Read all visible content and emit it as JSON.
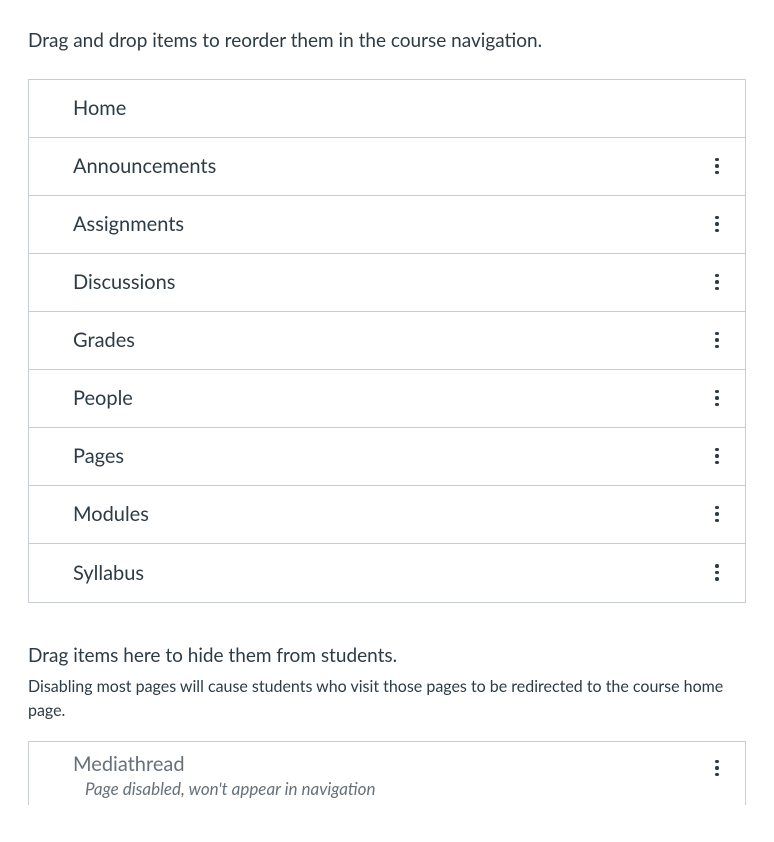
{
  "instructions": {
    "reorder": "Drag and drop items to reorder them in the course navigation.",
    "hide": "Drag items here to hide them from students.",
    "hide_note": "Disabling most pages will cause students who visit those pages to be redirected to the course home page."
  },
  "visible_items": [
    {
      "label": "Home",
      "has_menu": false
    },
    {
      "label": "Announcements",
      "has_menu": true
    },
    {
      "label": "Assignments",
      "has_menu": true
    },
    {
      "label": "Discussions",
      "has_menu": true
    },
    {
      "label": "Grades",
      "has_menu": true
    },
    {
      "label": "People",
      "has_menu": true
    },
    {
      "label": "Pages",
      "has_menu": true
    },
    {
      "label": "Modules",
      "has_menu": true
    },
    {
      "label": "Syllabus",
      "has_menu": true
    }
  ],
  "hidden_items": [
    {
      "label": "Mediathread",
      "sublabel": "Page disabled, won't appear in navigation",
      "has_menu": true
    }
  ]
}
